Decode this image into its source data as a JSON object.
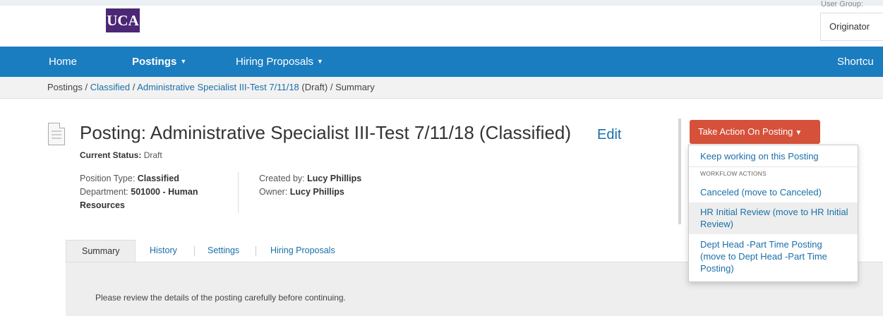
{
  "header": {
    "logo_text": "UCA",
    "user_group_label": "User Group:",
    "user_group_value": "Originator"
  },
  "nav": {
    "home": "Home",
    "postings": "Postings",
    "hiring_proposals": "Hiring Proposals",
    "shortcuts": "Shortcu"
  },
  "breadcrumb": {
    "root": "Postings",
    "classified": "Classified",
    "posting": "Administrative Specialist III-Test 7/11/18",
    "posting_suffix": "(Draft)",
    "current": "Summary",
    "separator": "/"
  },
  "posting": {
    "title": "Posting: Administrative Specialist III-Test 7/11/18 (Classified)",
    "edit_label": "Edit",
    "status_label": "Current Status:",
    "status_value": "Draft",
    "position_type_label": "Position Type:",
    "position_type_value": "Classified",
    "department_label": "Department:",
    "department_value": "501000 - Human Resources",
    "created_by_label": "Created by:",
    "created_by_value": "Lucy Phillips",
    "owner_label": "Owner:",
    "owner_value": "Lucy Phillips"
  },
  "tabs": [
    {
      "label": "Summary"
    },
    {
      "label": "History"
    },
    {
      "label": "Settings"
    },
    {
      "label": "Hiring Proposals"
    }
  ],
  "panel": {
    "message": "Please review the details of the posting carefully before continuing."
  },
  "actions": {
    "button_label": "Take Action On Posting",
    "keep_working": "Keep working on this Posting",
    "workflow_header": "WORKFLOW ACTIONS",
    "items": [
      {
        "label": "Canceled (move to Canceled)"
      },
      {
        "label": "HR Initial Review (move to HR Initial Review)"
      },
      {
        "label": "Dept Head -Part Time Posting (move to Dept Head -Part Time Posting)"
      }
    ]
  },
  "colors": {
    "nav_bg": "#1a7dbf",
    "action_button": "#d6513a",
    "link": "#1a6fa8",
    "logo_bg": "#4b2775"
  }
}
